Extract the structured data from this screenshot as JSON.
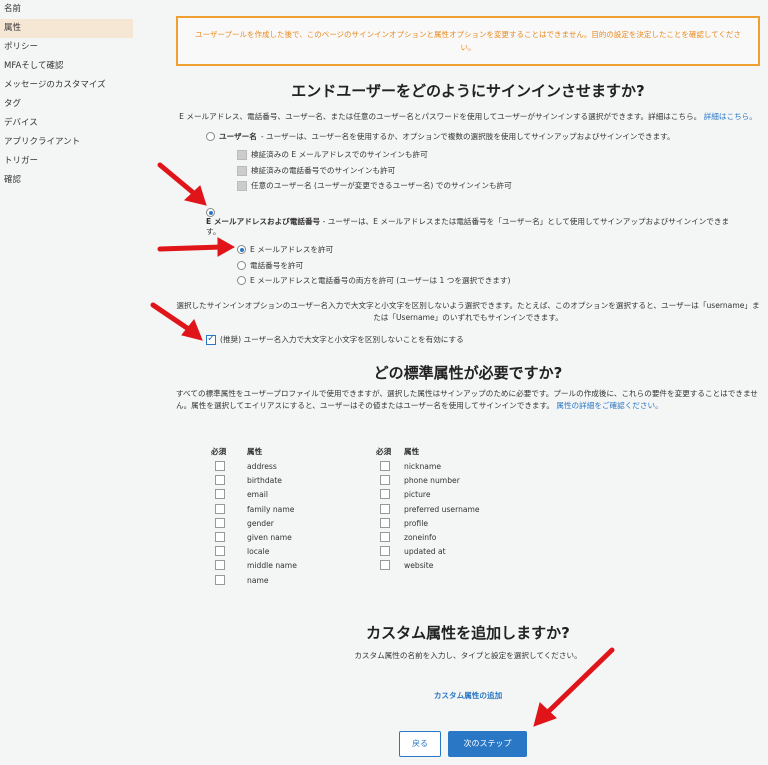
{
  "sidebar": {
    "items": [
      "名前",
      "属性",
      "ポリシー",
      "MFAそして確認",
      "メッセージのカスタマイズ",
      "タグ",
      "デバイス",
      "アプリクライアント",
      "トリガー",
      "確認"
    ]
  },
  "warning": "ユーザープールを作成した後で、このページのサインインオプションと属性オプションを変更することはできません。目的の設定を決定したことを確認してください。",
  "signin": {
    "title": "エンドユーザーをどのようにサインインさせますか?",
    "desc": "E メールアドレス、電話番号、ユーザー名、または任意のユーザー名とパスワードを使用してユーザーがサインインする選択ができます。詳細はこちら。",
    "desc_link": "詳細はこちら。",
    "username_label": "ユーザー名",
    "username_desc": " - ユーザーは、ユーザー名を使用するか、オプションで複数の選択肢を使用してサインアップおよびサインインできます。",
    "username_opts": [
      "検証済みの E メールアドレスでのサインインも許可",
      "検証済みの電話番号でのサインインも許可",
      "任意のユーザー名 (ユーザーが変更できるユーザー名) でのサインインも許可"
    ],
    "email_label": "E メールアドレスおよび電話番号",
    "email_desc": " - ユーザーは、E メールアドレスまたは電話番号を「ユーザー名」として使用してサインアップおよびサインインできます。",
    "email_opts": [
      "E メールアドレスを許可",
      "電話番号を許可",
      "E メールアドレスと電話番号の両方を許可 (ユーザーは 1 つを選択できます)"
    ],
    "case_desc": "選択したサインインオプションのユーザー名入力で大文字と小文字を区別しないよう選択できます。たとえば、このオプションを選択すると、ユーザーは「username」または「Username」のいずれでもサインインできます。",
    "case_label": "(推奨) ユーザー名入力で大文字と小文字を区別しないことを有効にする"
  },
  "attributes": {
    "title": "どの標準属性が必要ですか?",
    "desc": "すべての標準属性をユーザープロファイルで使用できますが、選択した属性はサインアップのために必要です。プールの作成後に、これらの要件を変更することはできません。属性を選択してエイリアスにすると、ユーザーはその値またはユーザー名を使用してサインインできます。",
    "desc_link": "属性の詳細をご確認ください。",
    "col_required": "必須",
    "col_attr": "属性",
    "left": [
      "address",
      "birthdate",
      "email",
      "family name",
      "gender",
      "given name",
      "locale",
      "middle name",
      "name"
    ],
    "right": [
      "nickname",
      "phone number",
      "picture",
      "preferred username",
      "profile",
      "zoneinfo",
      "updated at",
      "website"
    ]
  },
  "custom": {
    "title": "カスタム属性を追加しますか?",
    "desc": "カスタム属性の名前を入力し、タイプと設定を選択してください。",
    "link": "カスタム属性の追加"
  },
  "buttons": {
    "back": "戻る",
    "next": "次のステップ"
  }
}
